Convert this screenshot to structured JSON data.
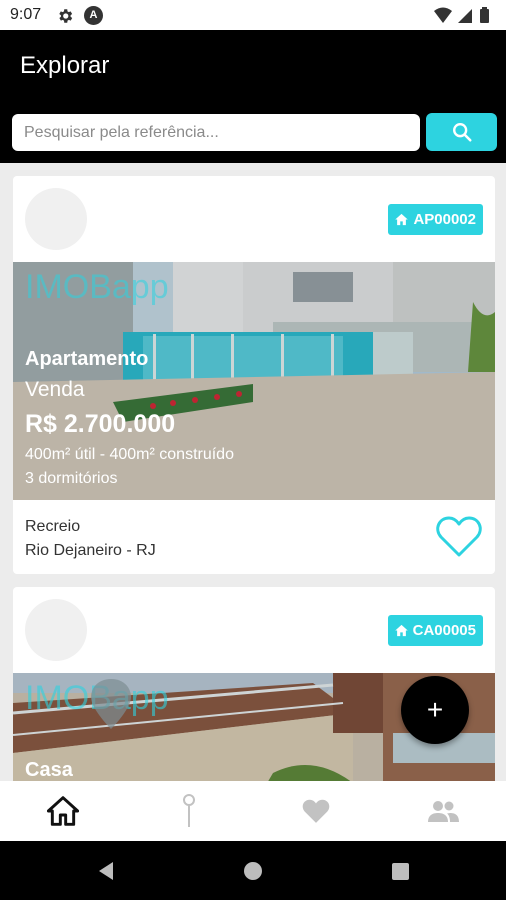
{
  "status_bar": {
    "time": "9:07",
    "a_icon": "A"
  },
  "app_bar": {
    "title": "Explorar"
  },
  "search": {
    "placeholder": "Pesquisar pela referência...",
    "value": ""
  },
  "colors": {
    "accent": "#2dd3e0",
    "app_bar": "#000000",
    "background": "#ececec"
  },
  "listings": [
    {
      "ref": "AP00002",
      "type": "Apartamento",
      "deal": "Venda",
      "price": "R$ 2.700.000",
      "area": "400m² útil - 400m² construído",
      "rooms": "3 dormitórios",
      "neighborhood": "Recreio",
      "city": "Rio Dejaneiro - RJ",
      "watermark": "IMOBapp"
    },
    {
      "ref": "CA00005",
      "type": "Casa",
      "watermark": "IMOBapp"
    }
  ],
  "bottom_nav": [
    {
      "icon": "home-icon",
      "active": true
    },
    {
      "icon": "map-pin-icon",
      "active": false
    },
    {
      "icon": "heart-icon",
      "active": false
    },
    {
      "icon": "people-icon",
      "active": false
    }
  ],
  "fab": {
    "label": "+"
  }
}
